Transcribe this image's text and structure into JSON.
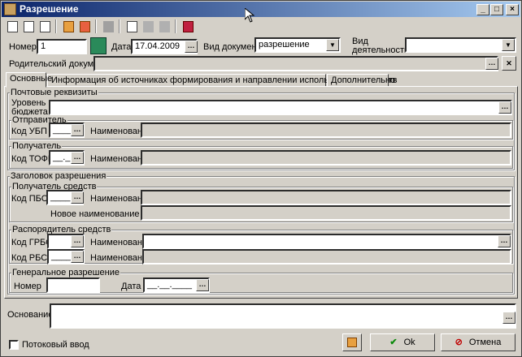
{
  "window": {
    "title": "Разрешение"
  },
  "header": {
    "number_label": "Номер",
    "number_value": "1",
    "date_label": "Дата",
    "date_value": "17.04.2009",
    "doc_type_label": "Вид документа",
    "doc_type_value": "разрешение",
    "activity_label": "Вид деятельности",
    "activity_value": "",
    "parent_doc_label": "Родительский документ",
    "parent_doc_value": ""
  },
  "tabs": [
    {
      "label": "Основные"
    },
    {
      "label": "Информация об источниках формирования и направлении использования средств"
    },
    {
      "label": "Дополнительно"
    }
  ],
  "postal": {
    "title": "Почтовые реквизиты",
    "budget_level_label": "Уровень бюджета",
    "sender_title": "Отправитель",
    "sender_code_label": "Код УБП",
    "sender_code_value": "____",
    "sender_name_label": "Наименование",
    "receiver_title": "Получатель",
    "receiver_code_label": "Код ТОФК",
    "receiver_code_value": "__._",
    "receiver_name_label": "Наименование"
  },
  "permit_header": {
    "title": "Заголовок разрешения",
    "recipient_title": "Получатель средств",
    "pbs_code_label": "Код ПБС",
    "pbs_code_value": "____",
    "pbs_name_label": "Наименование",
    "new_pbs_name_label": "Новое наименование ПБС",
    "distributor_title": "Распорядитель средств",
    "grbs_label": "Код ГРБС",
    "grbs_value": "",
    "grbs_name_label": "Наименование",
    "rbs_label": "Код РБС",
    "rbs_value": "____",
    "rbs_name_label": "Наименование",
    "general_title": "Генеральное разрешение",
    "gen_number_label": "Номер",
    "gen_number_value": "",
    "gen_date_label": "Дата",
    "gen_date_value": "__.__.____"
  },
  "footer": {
    "basis_label": "Основание",
    "basis_value": "",
    "stream_input_label": "Потоковый ввод",
    "ok_label": "Ok",
    "cancel_label": "Отмена"
  }
}
